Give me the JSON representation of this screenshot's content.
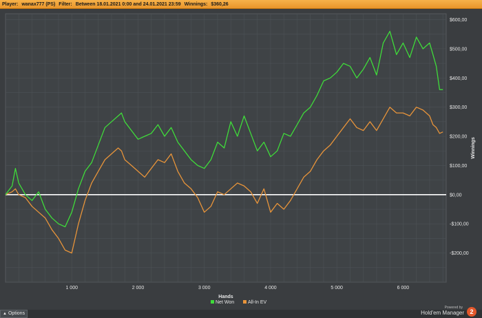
{
  "header": {
    "player_label": "Player:",
    "player_value": "wanax777 (PS)",
    "filter_label": "Filter:",
    "filter_value": "Between 18.01.2021 0:00 and 24.01.2021 23:59",
    "winnings_label": "Winnings:",
    "winnings_value": "$360,26"
  },
  "footer": {
    "options_label": "Options",
    "powered_by": "Powered by",
    "brand_name": "Hold'em Manager",
    "brand_version": "2"
  },
  "colors": {
    "net_won": "#3fdc3a",
    "all_in_ev": "#e8943a",
    "zero_line": "#ffffff",
    "grid": "#4d5256",
    "text": "#e6e6e6"
  },
  "chart_data": {
    "type": "line",
    "xlabel": "Hands",
    "ylabel": "Winnings",
    "xlim": [
      0,
      6650
    ],
    "ylim": [
      -300,
      620
    ],
    "x_ticks": [
      1000,
      2000,
      3000,
      4000,
      5000,
      6000
    ],
    "x_tick_labels": [
      "1 000",
      "2 000",
      "3 000",
      "4 000",
      "5 000",
      "6 000"
    ],
    "y_ticks": [
      600,
      500,
      400,
      300,
      200,
      100,
      0,
      -100,
      -200
    ],
    "y_tick_labels": [
      "$600,00",
      "$500,00",
      "$400,00",
      "$300,00",
      "$200,00",
      "$100,00",
      "$0,00",
      "-$100,00",
      "-$200,00"
    ],
    "legend_position": "bottom-center",
    "series": [
      {
        "name": "Net Won",
        "color": "#3fdc3a",
        "x": [
          0,
          100,
          150,
          200,
          300,
          400,
          500,
          600,
          700,
          800,
          900,
          1000,
          1100,
          1200,
          1300,
          1400,
          1500,
          1600,
          1700,
          1750,
          1800,
          1900,
          2000,
          2100,
          2200,
          2300,
          2400,
          2500,
          2600,
          2700,
          2800,
          2900,
          3000,
          3100,
          3200,
          3300,
          3400,
          3500,
          3600,
          3700,
          3800,
          3900,
          4000,
          4100,
          4200,
          4300,
          4400,
          4500,
          4600,
          4700,
          4800,
          4900,
          5000,
          5100,
          5200,
          5300,
          5400,
          5500,
          5600,
          5700,
          5800,
          5900,
          6000,
          6100,
          6200,
          6300,
          6400,
          6450,
          6500,
          6550,
          6600
        ],
        "y": [
          0,
          30,
          90,
          40,
          0,
          -20,
          10,
          -50,
          -80,
          -100,
          -110,
          -60,
          20,
          80,
          110,
          170,
          230,
          250,
          270,
          280,
          250,
          220,
          190,
          200,
          210,
          240,
          200,
          230,
          180,
          150,
          120,
          100,
          90,
          120,
          180,
          160,
          250,
          200,
          270,
          210,
          150,
          180,
          130,
          150,
          210,
          200,
          240,
          280,
          300,
          340,
          390,
          400,
          420,
          450,
          440,
          400,
          430,
          470,
          410,
          520,
          560,
          480,
          520,
          470,
          540,
          500,
          520,
          480,
          440,
          360,
          360
        ]
      },
      {
        "name": "All-In EV",
        "color": "#e8943a",
        "x": [
          0,
          100,
          150,
          200,
          300,
          400,
          500,
          600,
          700,
          800,
          900,
          1000,
          1100,
          1200,
          1300,
          1400,
          1500,
          1600,
          1700,
          1750,
          1800,
          1900,
          2000,
          2100,
          2200,
          2300,
          2400,
          2500,
          2600,
          2700,
          2800,
          2900,
          3000,
          3100,
          3200,
          3300,
          3400,
          3500,
          3600,
          3700,
          3800,
          3900,
          4000,
          4100,
          4200,
          4300,
          4400,
          4500,
          4600,
          4700,
          4800,
          4900,
          5000,
          5100,
          5200,
          5300,
          5400,
          5500,
          5600,
          5700,
          5800,
          5900,
          6000,
          6100,
          6200,
          6300,
          6400,
          6450,
          6500,
          6550,
          6600
        ],
        "y": [
          0,
          10,
          20,
          0,
          -10,
          -40,
          -60,
          -80,
          -120,
          -150,
          -190,
          -200,
          -100,
          -20,
          40,
          80,
          120,
          140,
          160,
          150,
          120,
          100,
          80,
          60,
          90,
          120,
          110,
          140,
          80,
          40,
          20,
          -10,
          -60,
          -40,
          10,
          0,
          20,
          40,
          30,
          10,
          -30,
          20,
          -60,
          -30,
          -50,
          -20,
          20,
          60,
          80,
          120,
          150,
          170,
          200,
          230,
          260,
          230,
          220,
          250,
          220,
          260,
          300,
          280,
          280,
          270,
          300,
          290,
          270,
          240,
          230,
          210,
          215
        ]
      }
    ]
  }
}
